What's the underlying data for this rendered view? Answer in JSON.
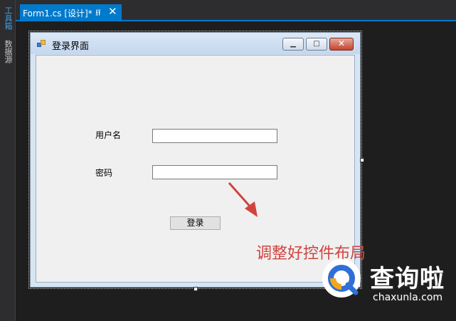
{
  "side_tabs": {
    "toolbox": "工具箱",
    "data_sources": "数据源"
  },
  "tabs": {
    "active_title": "Form1.cs [设计]*",
    "pin_icon": "pin-icon",
    "close_icon": "close-icon"
  },
  "form": {
    "title": "登录界面",
    "title_icon": "form-app-icon",
    "caption_buttons": {
      "minimize": "minimize-icon",
      "maximize": "maximize-icon",
      "close": "close-icon"
    },
    "labels": {
      "username": "用户名",
      "password": "密码"
    },
    "inputs": {
      "username_value": "",
      "password_value": ""
    },
    "login_button": "登录"
  },
  "annotation": {
    "text": "调整好控件布局",
    "color": "#d0443e"
  },
  "watermark": {
    "logo": "查询啦",
    "site": "chaxunla.com",
    "brand_colors": [
      "#2f6fd6",
      "#f2a81d"
    ]
  },
  "colors": {
    "accent": "#007acc",
    "background": "#1e1e1e",
    "form_client": "#f0f0f0"
  }
}
